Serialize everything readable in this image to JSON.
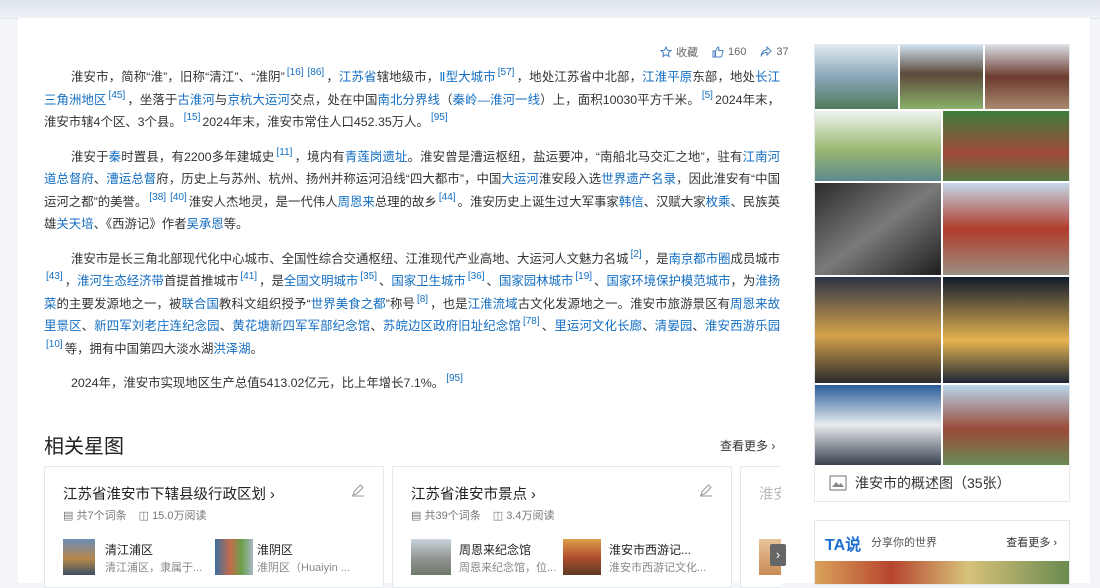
{
  "actions": {
    "favorite": "收藏",
    "likes": "160",
    "shares": "37"
  },
  "paragraphs": [
    [
      {
        "t": "淮安市，简称“淮”，旧称“清江”、“淮阴”"
      },
      {
        "r": "[16]"
      },
      {
        "r": "[86]"
      },
      {
        "t": "，"
      },
      {
        "l": "江苏省"
      },
      {
        "t": "辖地级市，"
      },
      {
        "l": "Ⅱ型大城市"
      },
      {
        "r": "[57]"
      },
      {
        "t": "，地处江苏省中北部，"
      },
      {
        "l": "江淮平原"
      },
      {
        "t": "东部，地处"
      },
      {
        "l": "长江三角洲地区"
      },
      {
        "r": "[45]"
      },
      {
        "t": "，坐落于"
      },
      {
        "l": "古淮河"
      },
      {
        "t": "与"
      },
      {
        "l": "京杭大运河"
      },
      {
        "t": "交点，处在中国"
      },
      {
        "l": "南北分界线"
      },
      {
        "t": "（"
      },
      {
        "l": "秦岭—淮河一线"
      },
      {
        "t": "）上，面积10030平方千米。"
      },
      {
        "r": "[5]"
      },
      {
        "t": "2024年末，淮安市辖4个区、3个县。"
      },
      {
        "r": "[15]"
      },
      {
        "t": "2024年末，淮安市常住人口452.35万人。"
      },
      {
        "r": "[95]"
      }
    ],
    [
      {
        "t": "淮安于"
      },
      {
        "l": "秦"
      },
      {
        "t": "时置县，有2200多年建城史"
      },
      {
        "r": "[11]"
      },
      {
        "t": "，境内有"
      },
      {
        "l": "青莲岗遗址"
      },
      {
        "t": "。淮安曾是漕运枢纽，盐运要冲，“南船北马交汇之地”，驻有"
      },
      {
        "l": "江南河道总督府"
      },
      {
        "t": "、"
      },
      {
        "l": "漕运总督"
      },
      {
        "t": "府，历史上与苏州、杭州、扬州并称运河沿线“四大都市”，中国"
      },
      {
        "l": "大运河"
      },
      {
        "t": "淮安段入选"
      },
      {
        "l": "世界遗产名录"
      },
      {
        "t": "，因此淮安有“中国运河之都”的美誉。"
      },
      {
        "r": "[38]"
      },
      {
        "r": "[40]"
      },
      {
        "t": "淮安人杰地灵，是一代伟人"
      },
      {
        "l": "周恩来"
      },
      {
        "t": "总理的故乡"
      },
      {
        "r": "[44]"
      },
      {
        "t": "。淮安历史上诞生过大军事家"
      },
      {
        "l": "韩信"
      },
      {
        "t": "、汉赋大家"
      },
      {
        "l": "枚乘"
      },
      {
        "t": "、民族英雄"
      },
      {
        "l": "关天培"
      },
      {
        "t": "、《西游记》作者"
      },
      {
        "l": "吴承恩"
      },
      {
        "t": "等。"
      }
    ],
    [
      {
        "t": "淮安市是长三角北部现代化中心城市、全国性综合交通枢纽、江淮现代产业高地、大运河人文魅力名城"
      },
      {
        "r": "[2]"
      },
      {
        "t": "，是"
      },
      {
        "l": "南京都市圈"
      },
      {
        "t": "成员城市"
      },
      {
        "r": "[43]"
      },
      {
        "t": "，"
      },
      {
        "l": "淮河生态经济带"
      },
      {
        "t": "首提首推城市"
      },
      {
        "r": "[41]"
      },
      {
        "t": "，是"
      },
      {
        "l": "全国文明城市"
      },
      {
        "r": "[35]"
      },
      {
        "t": "、"
      },
      {
        "l": "国家卫生城市"
      },
      {
        "r": "[36]"
      },
      {
        "t": "、"
      },
      {
        "l": "国家园林城市"
      },
      {
        "r": "[19]"
      },
      {
        "t": "、"
      },
      {
        "l": "国家环境保护模范城市"
      },
      {
        "t": "，为"
      },
      {
        "l": "淮扬菜"
      },
      {
        "t": "的主要发源地之一，被"
      },
      {
        "l": "联合国"
      },
      {
        "t": "教科文组织授予“"
      },
      {
        "l": "世界美食之都"
      },
      {
        "t": "”称号"
      },
      {
        "r": "[8]"
      },
      {
        "t": "，也是"
      },
      {
        "l": "江淮流域"
      },
      {
        "t": "古文化发源地之一。淮安市旅游景区有"
      },
      {
        "l": "周恩来故里景区"
      },
      {
        "t": "、"
      },
      {
        "l": "新四军刘老庄连纪念园"
      },
      {
        "t": "、"
      },
      {
        "l": "黄花塘新四军军部纪念馆"
      },
      {
        "t": "、"
      },
      {
        "l": "苏皖边区政府旧址纪念馆"
      },
      {
        "r": "[78]"
      },
      {
        "t": "、"
      },
      {
        "l": "里运河文化长廊"
      },
      {
        "t": "、"
      },
      {
        "l": "清晏园"
      },
      {
        "t": "、"
      },
      {
        "l": "淮安西游乐园"
      },
      {
        "r": "[10]"
      },
      {
        "t": "等，拥有中国第四大淡水湖"
      },
      {
        "l": "洪泽湖"
      },
      {
        "t": "。"
      }
    ],
    [
      {
        "t": "2024年，淮安市实现地区生产总值5413.02亿元，比上年增长7.1%。"
      },
      {
        "r": "[95]"
      }
    ]
  ],
  "related": {
    "title": "相关星图",
    "see_more": "查看更多",
    "cards": [
      {
        "title": "江苏省淮安市下辖县级行政区划",
        "count": "共7个词条",
        "reads": "15.0万阅读",
        "entries": [
          {
            "name": "清江浦区",
            "desc": "清江浦区，隶属于..."
          },
          {
            "name": "淮阴区",
            "desc": "淮阴区（Huaiyin ..."
          }
        ]
      },
      {
        "title": "江苏省淮安市景点",
        "count": "共39个词条",
        "reads": "3.4万阅读",
        "entries": [
          {
            "name": "周恩来纪念馆",
            "desc": "周恩来纪念馆，位..."
          },
          {
            "name": "淮安市西游记...",
            "desc": "淮安市西游记文化..."
          }
        ]
      }
    ],
    "peek_title": "淮安"
  },
  "gallery": {
    "caption": "淮安市的概述图（35张）"
  },
  "ta": {
    "logo": "TA说",
    "tagline": "分享你的世界",
    "more": "查看更多"
  }
}
